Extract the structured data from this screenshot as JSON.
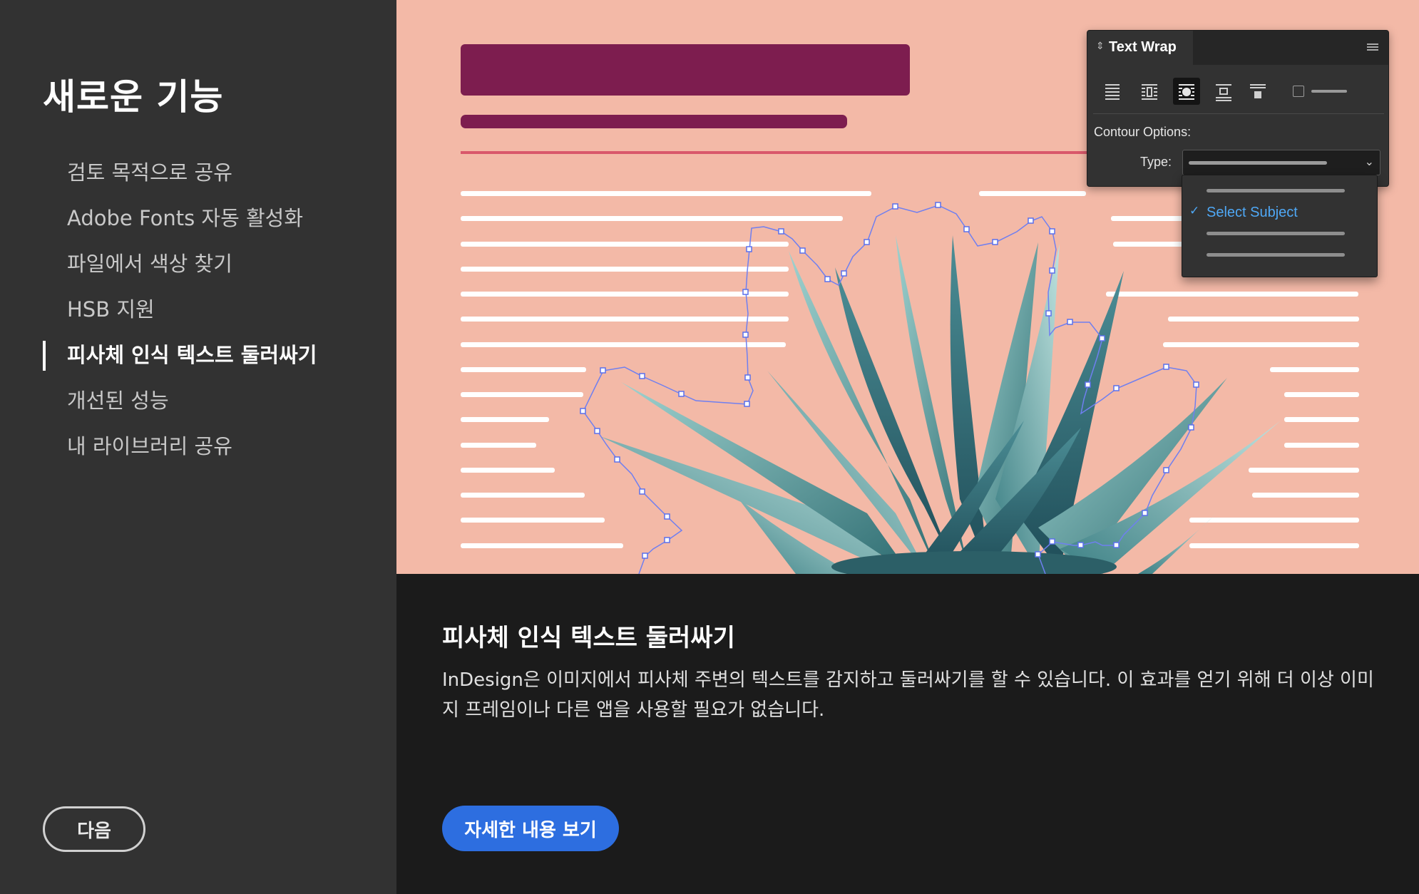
{
  "sidebar": {
    "title": "새로운 기능",
    "items": [
      {
        "label": "검토 목적으로 공유"
      },
      {
        "label": "Adobe Fonts 자동 활성화"
      },
      {
        "label": "파일에서 색상 찾기"
      },
      {
        "label": "HSB 지원"
      },
      {
        "label": "피사체 인식 텍스트 둘러싸기",
        "active": true
      },
      {
        "label": "개선된 성능"
      },
      {
        "label": "내 라이브러리 공유"
      }
    ],
    "next_button": "다음"
  },
  "panel": {
    "title": "Text Wrap",
    "contour_options_label": "Contour Options:",
    "type_label": "Type:",
    "dropdown_selected": "Select Subject",
    "wrap_icons": [
      "no-wrap-icon",
      "wrap-bounding-box-icon",
      "wrap-object-shape-icon",
      "jump-object-icon",
      "jump-next-column-icon"
    ],
    "selected_wrap": "wrap-object-shape-icon"
  },
  "description": {
    "title": "피사체 인식 텍스트 둘러싸기",
    "body": "InDesign은 이미지에서 피사체 주변의 텍스트를 감지하고 둘러싸기를 할 수 있습니다. 이 효과를 얻기 위해 더 이상 이미지 프레임이나 다른 앱을 사용할 필요가 없습니다.",
    "button": "자세한 내용 보기"
  },
  "colors": {
    "sidebar_bg": "#323232",
    "illustration_bg": "#f3b9a7",
    "headline_bar": "#7d1d4f",
    "rule_line": "#d9586b",
    "accent_blue": "#2d6ee0",
    "selection_blue": "#4fa8f5",
    "contour_path": "#6f7ff0"
  }
}
